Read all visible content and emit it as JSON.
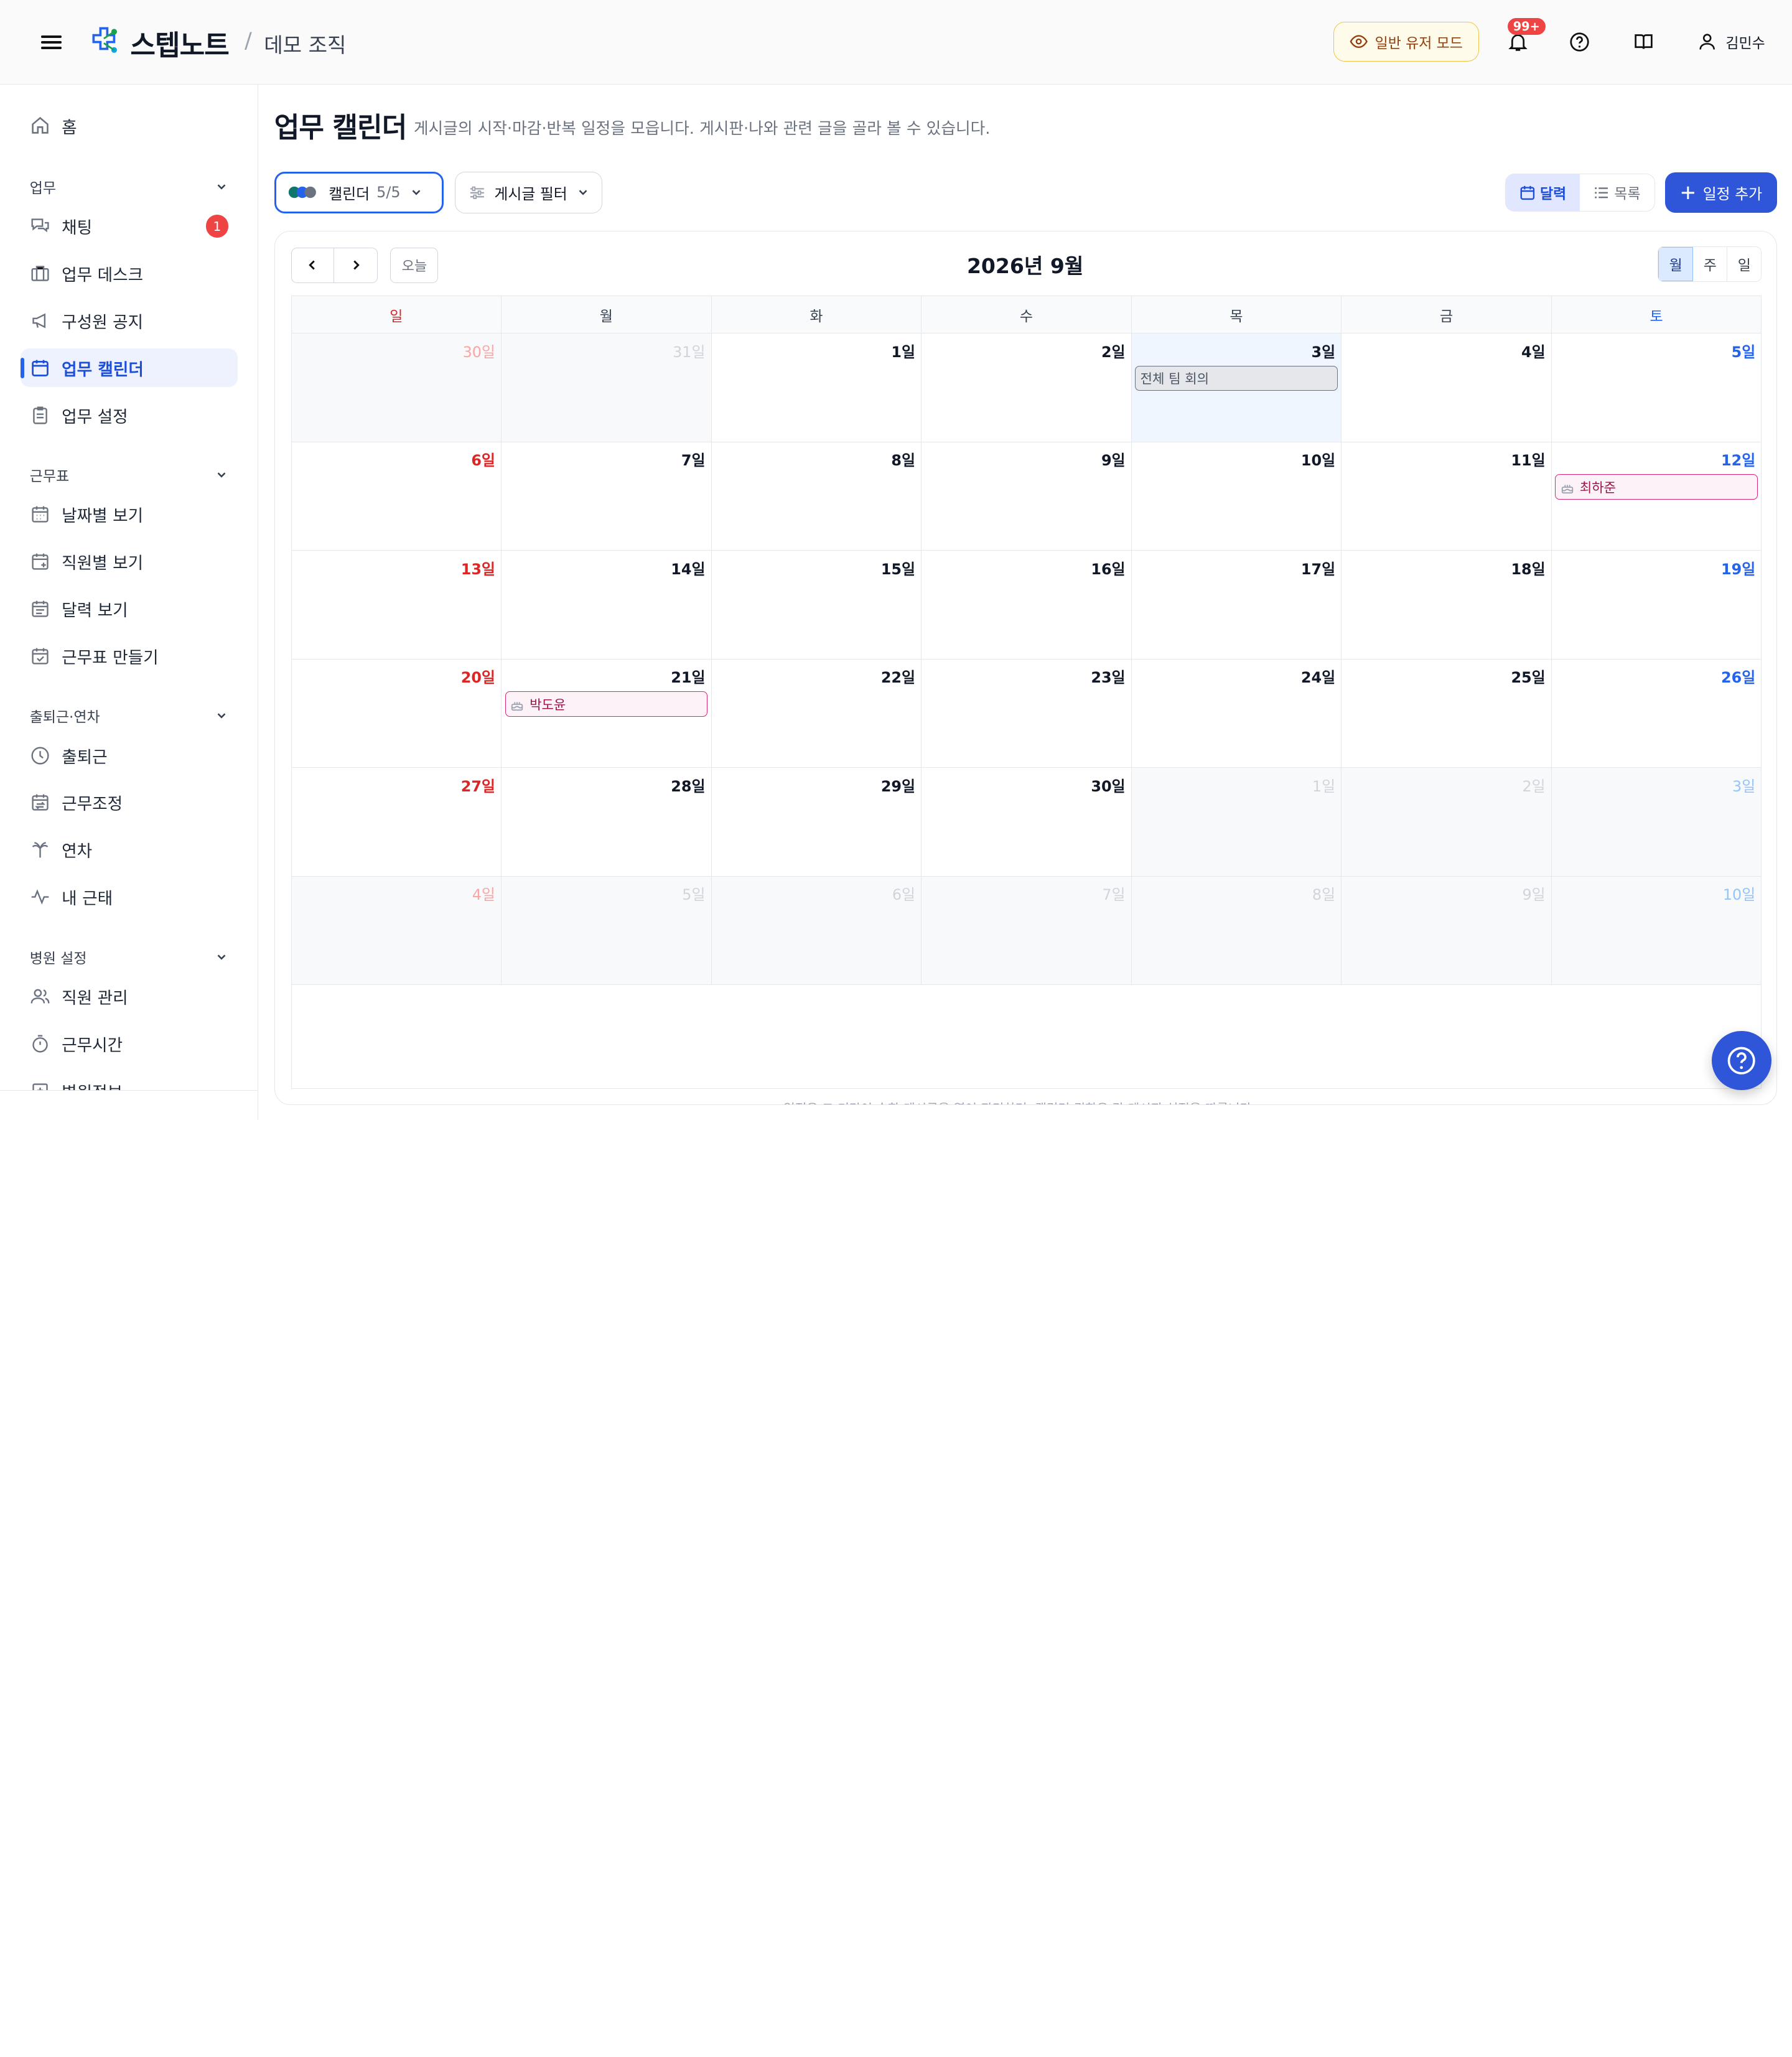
{
  "header": {
    "brand": "스텝노트",
    "separator": "/",
    "org": "데모 조직",
    "mode_button": "일반 유저 모드",
    "notification_badge": "99+",
    "user_name": "김민수"
  },
  "sidebar": {
    "home": "홈",
    "sections": [
      {
        "title": "업무",
        "items": [
          {
            "label": "채팅",
            "icon": "chat-icon",
            "badge": "1"
          },
          {
            "label": "업무 데스크",
            "icon": "desk-icon"
          },
          {
            "label": "구성원 공지",
            "icon": "megaphone-icon"
          },
          {
            "label": "업무 캘린더",
            "icon": "calendar-icon",
            "active": true
          },
          {
            "label": "업무 설정",
            "icon": "clipboard-icon"
          }
        ]
      },
      {
        "title": "근무표",
        "items": [
          {
            "label": "날짜별 보기",
            "icon": "calendar-grid-icon"
          },
          {
            "label": "직원별 보기",
            "icon": "calendar-plus-icon"
          },
          {
            "label": "달력 보기",
            "icon": "calendar-list-icon"
          },
          {
            "label": "근무표 만들기",
            "icon": "calendar-check-icon"
          }
        ]
      },
      {
        "title": "출퇴근·연차",
        "items": [
          {
            "label": "출퇴근",
            "icon": "clock-icon"
          },
          {
            "label": "근무조정",
            "icon": "calendar-swap-icon"
          },
          {
            "label": "연차",
            "icon": "palm-tree-icon"
          },
          {
            "label": "내 근태",
            "icon": "activity-icon"
          }
        ]
      },
      {
        "title": "병원 설정",
        "items": [
          {
            "label": "직원 관리",
            "icon": "users-icon"
          },
          {
            "label": "근무시간",
            "icon": "timer-icon"
          },
          {
            "label": "병원정보",
            "icon": "hospital-icon"
          }
        ]
      }
    ]
  },
  "page": {
    "title": "업무 캘린더",
    "subtitle": "게시글의 시작·마감·반복 일정을 모읍니다. 게시판·나와 관련 글을 골라 볼 수 있습니다.",
    "calendar_filter_label": "캘린더",
    "calendar_filter_count": "5/5",
    "post_filter_label": "게시글 필터",
    "view_month_label": "달력",
    "view_list_label": "목록",
    "add_button": "일정 추가",
    "today_button": "오늘",
    "month_title": "2026년 9월",
    "range_buttons": [
      "월",
      "주",
      "일"
    ],
    "weekdays": [
      "일",
      "월",
      "화",
      "수",
      "목",
      "금",
      "토"
    ],
    "footnote": "일정은 그 기간이 속한 게시글을 열어 관리하며, 캘린더 권한은 각 게시판 설정을 따릅니다."
  },
  "calendar": {
    "weeks": [
      [
        {
          "label": "30일",
          "other": true
        },
        {
          "label": "31일",
          "other": true
        },
        {
          "label": "1일"
        },
        {
          "label": "2일"
        },
        {
          "label": "3일",
          "today": true,
          "events": [
            {
              "title": "전체 팀 회의",
              "kind": "meeting"
            }
          ]
        },
        {
          "label": "4일"
        },
        {
          "label": "5일"
        }
      ],
      [
        {
          "label": "6일"
        },
        {
          "label": "7일"
        },
        {
          "label": "8일"
        },
        {
          "label": "9일"
        },
        {
          "label": "10일"
        },
        {
          "label": "11일"
        },
        {
          "label": "12일",
          "events": [
            {
              "title": "최하준",
              "kind": "birthday"
            }
          ]
        }
      ],
      [
        {
          "label": "13일"
        },
        {
          "label": "14일"
        },
        {
          "label": "15일"
        },
        {
          "label": "16일"
        },
        {
          "label": "17일"
        },
        {
          "label": "18일"
        },
        {
          "label": "19일"
        }
      ],
      [
        {
          "label": "20일"
        },
        {
          "label": "21일",
          "events": [
            {
              "title": "박도윤",
              "kind": "birthday"
            }
          ]
        },
        {
          "label": "22일"
        },
        {
          "label": "23일"
        },
        {
          "label": "24일"
        },
        {
          "label": "25일"
        },
        {
          "label": "26일"
        }
      ],
      [
        {
          "label": "27일"
        },
        {
          "label": "28일"
        },
        {
          "label": "29일"
        },
        {
          "label": "30일"
        },
        {
          "label": "1일",
          "other": true
        },
        {
          "label": "2일",
          "other": true
        },
        {
          "label": "3일",
          "other": true
        }
      ],
      [
        {
          "label": "4일",
          "other": true
        },
        {
          "label": "5일",
          "other": true
        },
        {
          "label": "6일",
          "other": true
        },
        {
          "label": "7일",
          "other": true
        },
        {
          "label": "8일",
          "other": true
        },
        {
          "label": "9일",
          "other": true
        },
        {
          "label": "10일",
          "other": true
        }
      ]
    ]
  },
  "colors": {
    "accent": "#2f56d8",
    "sunday": "#dc2626",
    "saturday": "#2563eb",
    "birthday": "#db2777",
    "today_bg": "#eff6ff",
    "mode_border": "#f0c34a"
  }
}
